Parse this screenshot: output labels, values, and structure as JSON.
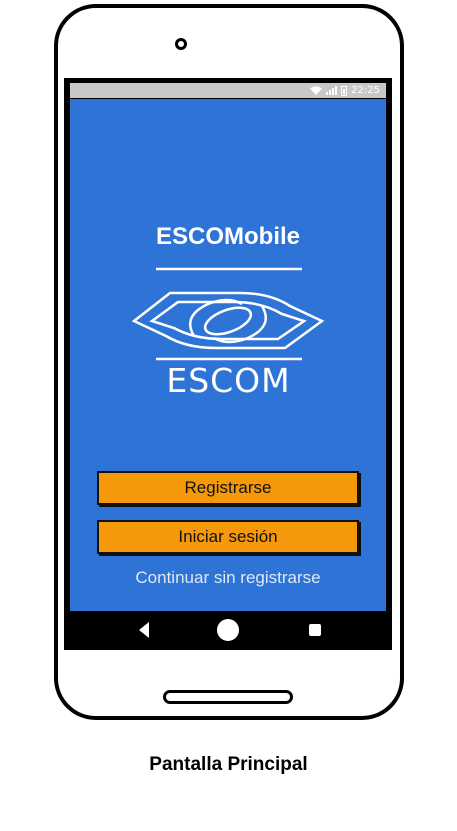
{
  "status_bar": {
    "time": "22:25",
    "icons": [
      "wifi-icon",
      "signal-icon",
      "battery-icon"
    ]
  },
  "app": {
    "title": "ESCOMobile",
    "logo_text": "ESCOM"
  },
  "buttons": {
    "register": "Registrarse",
    "login": "Iniciar sesión"
  },
  "links": {
    "skip": "Continuar sin registrarse"
  },
  "nav_bar": {
    "icons": [
      "back-icon",
      "home-icon",
      "recent-apps-icon"
    ]
  },
  "caption": "Pantalla Principal",
  "colors": {
    "screen_background": "#2e73d6",
    "button": "#f5980a",
    "text": "#ffffff"
  }
}
